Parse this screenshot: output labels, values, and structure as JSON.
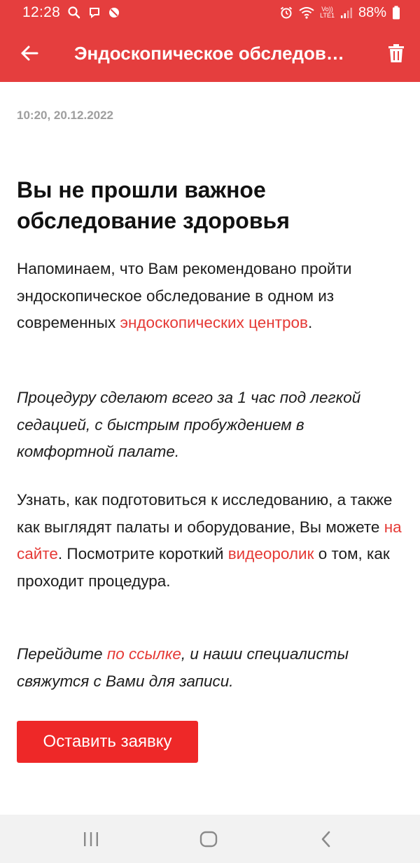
{
  "status_bar": {
    "time": "12:28",
    "lte_top": "Vo))",
    "lte_bottom": "LTE1",
    "battery": "88%",
    "left_icons": [
      "search-icon",
      "chat-icon",
      "no-sign-icon"
    ],
    "right_icons": [
      "alarm-icon",
      "wifi-icon",
      "volte-icon",
      "signal-icon",
      "battery-icon"
    ]
  },
  "app_bar": {
    "title": "Эндоскопическое обследов…",
    "back_icon": "arrow-left-icon",
    "delete_icon": "trash-icon"
  },
  "message": {
    "timestamp": "10:20, 20.12.2022",
    "headline": "Вы не прошли важное обследование здоровья",
    "p1": {
      "text_before": "Напоминаем, что Вам рекомендовано пройти эндоскопическое обследование в одном из современных ",
      "link": "эндоскопических центров",
      "text_after": "."
    },
    "p2": "Процедуру сделают всего за 1 час под легкой седацией, с быстрым пробуждением в комфортной палате.",
    "p3": {
      "text_before": "Узнать, как подготовиться к исследованию, а также как выглядят палаты и оборудование, Вы можете ",
      "link1": "на сайте",
      "text_middle": ". Посмотрите короткий ",
      "link2": "видеоролик",
      "text_after": " о том, как проходит процедура."
    },
    "p4": {
      "text_before": "Перейдите ",
      "link": "по ссылке",
      "text_after": ", и наши специалисты свяжутся с Вами для записи."
    },
    "cta_label": "Оставить заявку"
  },
  "nav_bar": {
    "icons": [
      "recent-apps-icon",
      "home-icon",
      "back-chevron-icon"
    ]
  },
  "colors": {
    "accent": "#e53e3e",
    "link": "#e53935",
    "button": "#ee2828",
    "timestamp": "#9e9e9e",
    "nav_bg": "#f2f2f2"
  }
}
